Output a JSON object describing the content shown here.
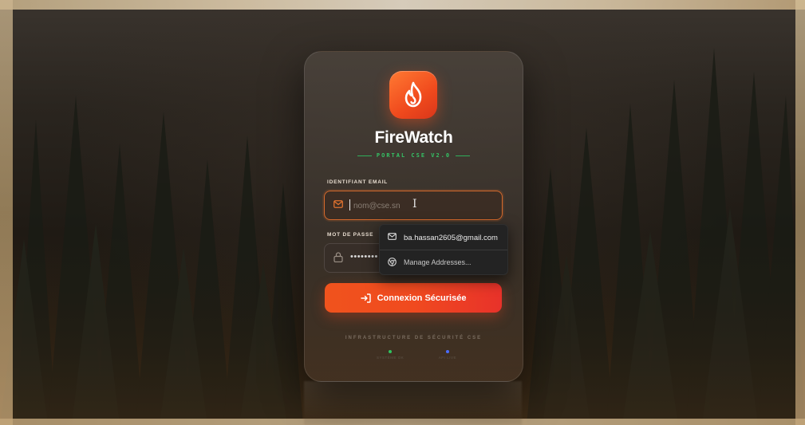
{
  "brand": {
    "name": "FireWatch",
    "subtitle": "PORTAL CSE V2.0",
    "accent_color": "#f04a1d",
    "subtitle_color": "#35c265"
  },
  "email": {
    "label": "IDENTIFIANT EMAIL",
    "placeholder": "nom@cse.sn",
    "value": "",
    "icon": "mail-icon"
  },
  "password": {
    "label": "MOT DE PASSE",
    "value_masked": "••••••••",
    "icon": "lock-icon"
  },
  "login_button": {
    "label": "Connexion Sécurisée",
    "icon": "login-arrow-icon"
  },
  "footer": {
    "text": "INFRASTRUCTURE DE SÉCURITÉ CSE",
    "statuses": [
      {
        "text": "SYSTÈME OK",
        "color": "#2fc35f"
      },
      {
        "text": "API LIVE",
        "color": "#4a6cff"
      }
    ]
  },
  "autofill": {
    "suggestion": "ba.hassan2605@gmail.com",
    "manage_label": "Manage Addresses..."
  }
}
